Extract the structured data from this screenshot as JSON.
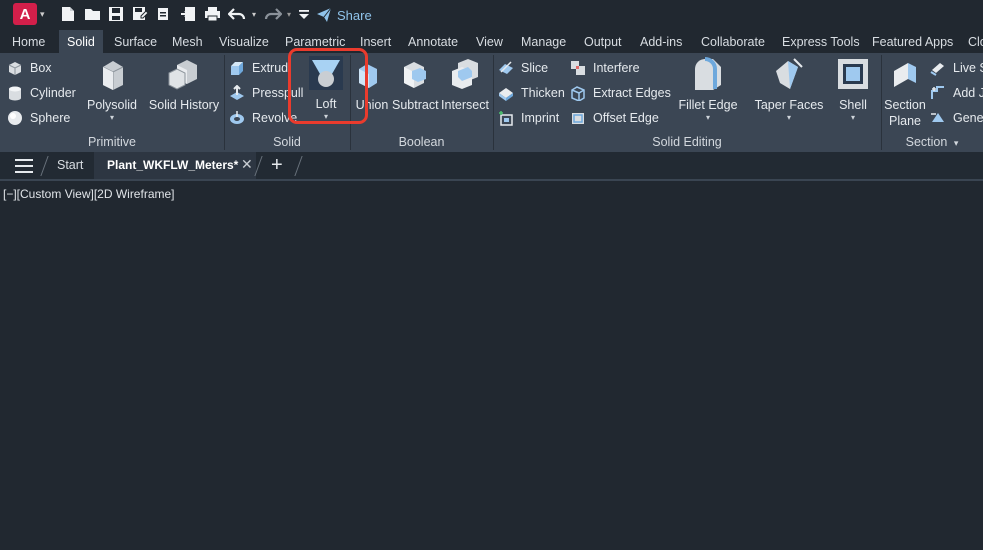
{
  "app": {
    "logo_letter": "A",
    "accent": "#d31f4a"
  },
  "quick_access": {
    "share_label": "Share",
    "icons": [
      "new-icon",
      "open-icon",
      "save-icon",
      "saveas-icon",
      "import-icon",
      "export-icon",
      "print-icon",
      "undo-icon",
      "redo-icon",
      "customize-icon",
      "share-icon"
    ]
  },
  "ribbon_tabs": [
    {
      "label": "Home",
      "active": false
    },
    {
      "label": "Solid",
      "active": true
    },
    {
      "label": "Surface",
      "active": false
    },
    {
      "label": "Mesh",
      "active": false
    },
    {
      "label": "Visualize",
      "active": false
    },
    {
      "label": "Parametric",
      "active": false
    },
    {
      "label": "Insert",
      "active": false
    },
    {
      "label": "Annotate",
      "active": false
    },
    {
      "label": "View",
      "active": false
    },
    {
      "label": "Manage",
      "active": false
    },
    {
      "label": "Output",
      "active": false
    },
    {
      "label": "Add-ins",
      "active": false
    },
    {
      "label": "Collaborate",
      "active": false
    },
    {
      "label": "Express Tools",
      "active": false
    },
    {
      "label": "Featured Apps",
      "active": false
    },
    {
      "label": "Clo",
      "active": false
    }
  ],
  "panels": {
    "primitive": {
      "title": "Primitive",
      "box": "Box",
      "cylinder": "Cylinder",
      "sphere": "Sphere",
      "polysolid": "Polysolid",
      "solid_history": "Solid History"
    },
    "solid": {
      "title": "Solid",
      "extrude": "Extrud",
      "presspull": "Presspull",
      "revolve": "Revolve",
      "loft": "Loft"
    },
    "boolean": {
      "title": "Boolean",
      "union": "Union",
      "subtract": "Subtract",
      "intersect": "Intersect"
    },
    "solid_editing": {
      "title": "Solid Editing",
      "slice": "Slice",
      "thicken": "Thicken",
      "imprint": "Imprint",
      "interfere": "Interfere",
      "extract_edges": "Extract Edges",
      "offset_edge": "Offset Edge",
      "fillet_edge": "Fillet Edge",
      "taper_faces": "Taper Faces",
      "shell": "Shell"
    },
    "section": {
      "title": "Section",
      "section_plane_1": "Section",
      "section_plane_2": "Plane",
      "live_section": "Live S",
      "add_jog": "Add J",
      "generate": "Gener"
    }
  },
  "document_tabs": {
    "start": "Start",
    "active_file": "Plant_WKFLW_Meters*",
    "add": "+"
  },
  "viewport": {
    "label": "[−][Custom View][2D Wireframe]"
  },
  "highlight_color": "#ea3b2d"
}
